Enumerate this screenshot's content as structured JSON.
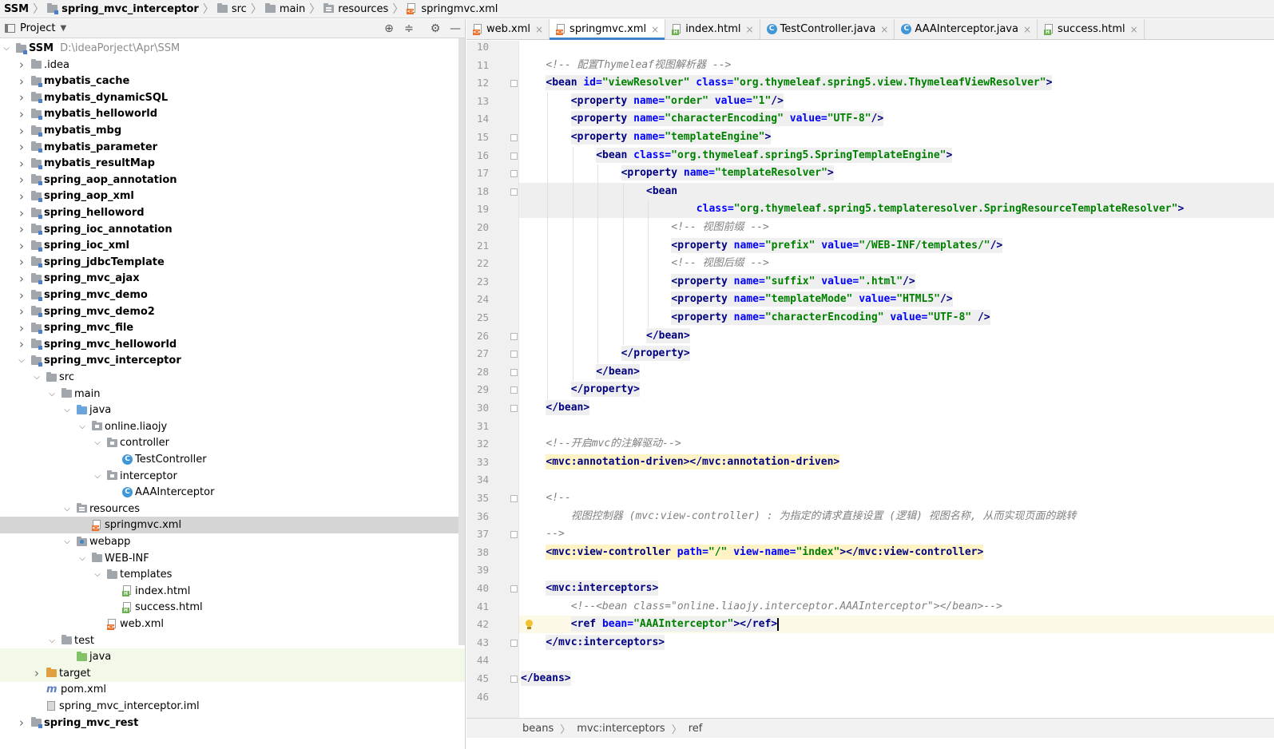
{
  "breadcrumbs": [
    {
      "label": "SSM",
      "icon": "none",
      "bold": true
    },
    {
      "label": "spring_mvc_interceptor",
      "icon": "module-folder-icon",
      "bold": true
    },
    {
      "label": "src",
      "icon": "folder-icon",
      "bold": false
    },
    {
      "label": "main",
      "icon": "folder-icon",
      "bold": false
    },
    {
      "label": "resources",
      "icon": "resources-folder-icon",
      "bold": false
    },
    {
      "label": "springmvc.xml",
      "icon": "xml-file-icon",
      "bold": false
    }
  ],
  "project_panel": {
    "title": "Project",
    "tree": [
      {
        "level": 0,
        "arrow": "open",
        "icon": "module",
        "label": "SSM",
        "bold": true,
        "path": "D:\\ideaPorject\\Apr\\SSM"
      },
      {
        "level": 1,
        "arrow": "closed",
        "icon": "folder",
        "label": ".idea",
        "bold": false
      },
      {
        "level": 1,
        "arrow": "closed",
        "icon": "module",
        "label": "mybatis_cache",
        "bold": true
      },
      {
        "level": 1,
        "arrow": "closed",
        "icon": "module",
        "label": "mybatis_dynamicSQL",
        "bold": true
      },
      {
        "level": 1,
        "arrow": "closed",
        "icon": "module",
        "label": "mybatis_helloworld",
        "bold": true
      },
      {
        "level": 1,
        "arrow": "closed",
        "icon": "module",
        "label": "mybatis_mbg",
        "bold": true
      },
      {
        "level": 1,
        "arrow": "closed",
        "icon": "module",
        "label": "mybatis_parameter",
        "bold": true
      },
      {
        "level": 1,
        "arrow": "closed",
        "icon": "module",
        "label": "mybatis_resultMap",
        "bold": true
      },
      {
        "level": 1,
        "arrow": "closed",
        "icon": "module",
        "label": "spring_aop_annotation",
        "bold": true
      },
      {
        "level": 1,
        "arrow": "closed",
        "icon": "module",
        "label": "spring_aop_xml",
        "bold": true
      },
      {
        "level": 1,
        "arrow": "closed",
        "icon": "module",
        "label": "spring_helloword",
        "bold": true
      },
      {
        "level": 1,
        "arrow": "closed",
        "icon": "module",
        "label": "spring_ioc_annotation",
        "bold": true
      },
      {
        "level": 1,
        "arrow": "closed",
        "icon": "module",
        "label": "spring_ioc_xml",
        "bold": true
      },
      {
        "level": 1,
        "arrow": "closed",
        "icon": "module",
        "label": "spring_jdbcTemplate",
        "bold": true
      },
      {
        "level": 1,
        "arrow": "closed",
        "icon": "module",
        "label": "spring_mvc_ajax",
        "bold": true
      },
      {
        "level": 1,
        "arrow": "closed",
        "icon": "module",
        "label": "spring_mvc_demo",
        "bold": true
      },
      {
        "level": 1,
        "arrow": "closed",
        "icon": "module",
        "label": "spring_mvc_demo2",
        "bold": true
      },
      {
        "level": 1,
        "arrow": "closed",
        "icon": "module",
        "label": "spring_mvc_file",
        "bold": true
      },
      {
        "level": 1,
        "arrow": "closed",
        "icon": "module",
        "label": "spring_mvc_helloworld",
        "bold": true
      },
      {
        "level": 1,
        "arrow": "open",
        "icon": "module",
        "label": "spring_mvc_interceptor",
        "bold": true
      },
      {
        "level": 2,
        "arrow": "open",
        "icon": "folder",
        "label": "src",
        "bold": false
      },
      {
        "level": 3,
        "arrow": "open",
        "icon": "folder",
        "label": "main",
        "bold": false
      },
      {
        "level": 4,
        "arrow": "open",
        "icon": "folder-blue",
        "label": "java",
        "bold": false
      },
      {
        "level": 5,
        "arrow": "open",
        "icon": "package",
        "label": "online.liaojy",
        "bold": false
      },
      {
        "level": 6,
        "arrow": "open",
        "icon": "package",
        "label": "controller",
        "bold": false
      },
      {
        "level": 7,
        "arrow": "none",
        "icon": "class",
        "label": "TestController",
        "bold": false
      },
      {
        "level": 6,
        "arrow": "open",
        "icon": "package",
        "label": "interceptor",
        "bold": false
      },
      {
        "level": 7,
        "arrow": "none",
        "icon": "class",
        "label": "AAAInterceptor",
        "bold": false
      },
      {
        "level": 4,
        "arrow": "open",
        "icon": "resources",
        "label": "resources",
        "bold": false
      },
      {
        "level": 5,
        "arrow": "none",
        "icon": "xml",
        "label": "springmvc.xml",
        "bold": false,
        "selected": true
      },
      {
        "level": 4,
        "arrow": "open",
        "icon": "webapp",
        "label": "webapp",
        "bold": false
      },
      {
        "level": 5,
        "arrow": "open",
        "icon": "folder",
        "label": "WEB-INF",
        "bold": false
      },
      {
        "level": 6,
        "arrow": "open",
        "icon": "folder",
        "label": "templates",
        "bold": false
      },
      {
        "level": 7,
        "arrow": "none",
        "icon": "html",
        "label": "index.html",
        "bold": false
      },
      {
        "level": 7,
        "arrow": "none",
        "icon": "html",
        "label": "success.html",
        "bold": false
      },
      {
        "level": 6,
        "arrow": "none",
        "icon": "xml",
        "label": "web.xml",
        "bold": false
      },
      {
        "level": 3,
        "arrow": "open",
        "icon": "folder",
        "label": "test",
        "bold": false
      },
      {
        "level": 4,
        "arrow": "none",
        "icon": "folder-green",
        "label": "java",
        "bold": false,
        "highlight": true
      },
      {
        "level": 2,
        "arrow": "closed",
        "icon": "folder-orange",
        "label": "target",
        "bold": false,
        "highlight": true
      },
      {
        "level": 2,
        "arrow": "none",
        "icon": "maven",
        "label": "pom.xml",
        "bold": false
      },
      {
        "level": 2,
        "arrow": "none",
        "icon": "iml",
        "label": "spring_mvc_interceptor.iml",
        "bold": false
      },
      {
        "level": 1,
        "arrow": "closed",
        "icon": "module",
        "label": "spring_mvc_rest",
        "bold": true
      }
    ]
  },
  "tabs": [
    {
      "label": "web.xml",
      "icon": "xml",
      "active": false
    },
    {
      "label": "springmvc.xml",
      "icon": "xml",
      "active": true
    },
    {
      "label": "index.html",
      "icon": "html",
      "active": false
    },
    {
      "label": "TestController.java",
      "icon": "class",
      "active": false
    },
    {
      "label": "AAAInterceptor.java",
      "icon": "class",
      "active": false
    },
    {
      "label": "success.html",
      "icon": "html",
      "active": false
    }
  ],
  "editor": {
    "current_line": 42,
    "lines": [
      {
        "n": "10",
        "fold": false,
        "segs": []
      },
      {
        "n": "11",
        "fold": false,
        "indent": 1,
        "segs": [
          {
            "c": "cm",
            "t": "<!-- 配置Thymeleaf视图解析器 -->"
          }
        ]
      },
      {
        "n": "12",
        "fold": true,
        "indent": 1,
        "bg": "bg",
        "segs": [
          {
            "c": "tg",
            "t": "<bean "
          },
          {
            "c": "at",
            "t": "id="
          },
          {
            "c": "av",
            "t": "\"viewResolver\""
          },
          {
            "c": "tg",
            "t": " "
          },
          {
            "c": "at",
            "t": "class="
          },
          {
            "c": "av",
            "t": "\"org.thymeleaf.spring5.view.ThymeleafViewResolver\""
          },
          {
            "c": "tg",
            "t": ">"
          }
        ]
      },
      {
        "n": "13",
        "fold": false,
        "indent": 2,
        "bg": "bg",
        "segs": [
          {
            "c": "tg",
            "t": "<property "
          },
          {
            "c": "at",
            "t": "name="
          },
          {
            "c": "av",
            "t": "\"order\""
          },
          {
            "c": "tg",
            "t": " "
          },
          {
            "c": "at",
            "t": "value="
          },
          {
            "c": "av",
            "t": "\"1\""
          },
          {
            "c": "tg",
            "t": "/>"
          }
        ]
      },
      {
        "n": "14",
        "fold": false,
        "indent": 2,
        "bg": "bg",
        "segs": [
          {
            "c": "tg",
            "t": "<property "
          },
          {
            "c": "at",
            "t": "name="
          },
          {
            "c": "av",
            "t": "\"characterEncoding\""
          },
          {
            "c": "tg",
            "t": " "
          },
          {
            "c": "at",
            "t": "value="
          },
          {
            "c": "av",
            "t": "\"UTF-8\""
          },
          {
            "c": "tg",
            "t": "/>"
          }
        ]
      },
      {
        "n": "15",
        "fold": true,
        "indent": 2,
        "bg": "bg",
        "segs": [
          {
            "c": "tg",
            "t": "<property "
          },
          {
            "c": "at",
            "t": "name="
          },
          {
            "c": "av",
            "t": "\"templateEngine\""
          },
          {
            "c": "tg",
            "t": ">"
          }
        ]
      },
      {
        "n": "16",
        "fold": true,
        "indent": 3,
        "bg": "bg",
        "segs": [
          {
            "c": "tg",
            "t": "<bean "
          },
          {
            "c": "at",
            "t": "class="
          },
          {
            "c": "av",
            "t": "\"org.thymeleaf.spring5.SpringTemplateEngine\""
          },
          {
            "c": "tg",
            "t": ">"
          }
        ]
      },
      {
        "n": "17",
        "fold": true,
        "indent": 4,
        "bg": "bg",
        "segs": [
          {
            "c": "tg",
            "t": "<property "
          },
          {
            "c": "at",
            "t": "name="
          },
          {
            "c": "av",
            "t": "\"templateResolver\""
          },
          {
            "c": "tg",
            "t": ">"
          }
        ]
      },
      {
        "n": "18",
        "fold": true,
        "indent": 5,
        "bg": "bg",
        "fullbg": true,
        "segs": [
          {
            "c": "tg",
            "t": "<bean"
          }
        ]
      },
      {
        "n": "19",
        "fold": false,
        "indent": 7,
        "bg": "bg",
        "fullbg": true,
        "segs": [
          {
            "c": "at",
            "t": "class="
          },
          {
            "c": "av",
            "t": "\"org.thymeleaf.spring5.templateresolver.SpringResourceTemplateResolver\""
          },
          {
            "c": "tg",
            "t": ">"
          }
        ]
      },
      {
        "n": "20",
        "fold": false,
        "indent": 6,
        "segs": [
          {
            "c": "cm",
            "t": "<!-- 视图前缀 -->"
          }
        ]
      },
      {
        "n": "21",
        "fold": false,
        "indent": 6,
        "bg": "bg",
        "segs": [
          {
            "c": "tg",
            "t": "<property "
          },
          {
            "c": "at",
            "t": "name="
          },
          {
            "c": "av",
            "t": "\"prefix\""
          },
          {
            "c": "tg",
            "t": " "
          },
          {
            "c": "at",
            "t": "value="
          },
          {
            "c": "av",
            "t": "\"/WEB-INF/templates/\""
          },
          {
            "c": "tg",
            "t": "/>"
          }
        ]
      },
      {
        "n": "22",
        "fold": false,
        "indent": 6,
        "segs": [
          {
            "c": "cm",
            "t": "<!-- 视图后缀 -->"
          }
        ]
      },
      {
        "n": "23",
        "fold": false,
        "indent": 6,
        "bg": "bg",
        "segs": [
          {
            "c": "tg",
            "t": "<property "
          },
          {
            "c": "at",
            "t": "name="
          },
          {
            "c": "av",
            "t": "\"suffix\""
          },
          {
            "c": "tg",
            "t": " "
          },
          {
            "c": "at",
            "t": "value="
          },
          {
            "c": "av",
            "t": "\".html\""
          },
          {
            "c": "tg",
            "t": "/>"
          }
        ]
      },
      {
        "n": "24",
        "fold": false,
        "indent": 6,
        "bg": "bg",
        "segs": [
          {
            "c": "tg",
            "t": "<property "
          },
          {
            "c": "at",
            "t": "name="
          },
          {
            "c": "av",
            "t": "\"templateMode\""
          },
          {
            "c": "tg",
            "t": " "
          },
          {
            "c": "at",
            "t": "value="
          },
          {
            "c": "av",
            "t": "\"HTML5\""
          },
          {
            "c": "tg",
            "t": "/>"
          }
        ]
      },
      {
        "n": "25",
        "fold": false,
        "indent": 6,
        "bg": "bg",
        "segs": [
          {
            "c": "tg",
            "t": "<property "
          },
          {
            "c": "at",
            "t": "name="
          },
          {
            "c": "av",
            "t": "\"characterEncoding\""
          },
          {
            "c": "tg",
            "t": " "
          },
          {
            "c": "at",
            "t": "value="
          },
          {
            "c": "av",
            "t": "\"UTF-8\""
          },
          {
            "c": "tg",
            "t": " />"
          }
        ]
      },
      {
        "n": "26",
        "fold": true,
        "indent": 5,
        "bg": "bg",
        "segs": [
          {
            "c": "tg",
            "t": "</bean>"
          }
        ]
      },
      {
        "n": "27",
        "fold": true,
        "indent": 4,
        "bg": "bg",
        "segs": [
          {
            "c": "tg",
            "t": "</property>"
          }
        ]
      },
      {
        "n": "28",
        "fold": true,
        "indent": 3,
        "bg": "bg",
        "segs": [
          {
            "c": "tg",
            "t": "</bean>"
          }
        ]
      },
      {
        "n": "29",
        "fold": true,
        "indent": 2,
        "bg": "bg",
        "segs": [
          {
            "c": "tg",
            "t": "</property>"
          }
        ]
      },
      {
        "n": "30",
        "fold": true,
        "indent": 1,
        "bg": "bg",
        "segs": [
          {
            "c": "tg",
            "t": "</bean>"
          }
        ]
      },
      {
        "n": "31",
        "fold": false,
        "segs": []
      },
      {
        "n": "32",
        "fold": false,
        "indent": 1,
        "segs": [
          {
            "c": "cm",
            "t": "<!--开启mvc的注解驱动-->"
          }
        ]
      },
      {
        "n": "33",
        "fold": false,
        "indent": 1,
        "bg": "ybg",
        "segs": [
          {
            "c": "tg",
            "t": "<mvc:annotation-driven></mvc:annotation-driven>"
          }
        ]
      },
      {
        "n": "34",
        "fold": false,
        "segs": []
      },
      {
        "n": "35",
        "fold": true,
        "indent": 1,
        "segs": [
          {
            "c": "cm",
            "t": "<!--"
          }
        ]
      },
      {
        "n": "36",
        "fold": false,
        "indent": 2,
        "segs": [
          {
            "c": "cm",
            "t": "视图控制器 (mvc:view-controller) : 为指定的请求直接设置 (逻辑) 视图名称, 从而实现页面的跳转"
          }
        ]
      },
      {
        "n": "37",
        "fold": true,
        "indent": 1,
        "segs": [
          {
            "c": "cm",
            "t": "-->"
          }
        ]
      },
      {
        "n": "38",
        "fold": false,
        "indent": 1,
        "bg": "ybg",
        "segs": [
          {
            "c": "tg",
            "t": "<mvc:view-controller "
          },
          {
            "c": "at",
            "t": "path="
          },
          {
            "c": "av",
            "t": "\"/\""
          },
          {
            "c": "tg",
            "t": " "
          },
          {
            "c": "at",
            "t": "view-name="
          },
          {
            "c": "av",
            "t": "\"index\""
          },
          {
            "c": "tg",
            "t": "></mvc:view-controller>"
          }
        ]
      },
      {
        "n": "39",
        "fold": false,
        "segs": []
      },
      {
        "n": "40",
        "fold": true,
        "indent": 1,
        "bg": "bg",
        "segs": [
          {
            "c": "tg",
            "t": "<mvc:interceptors>"
          }
        ]
      },
      {
        "n": "41",
        "fold": false,
        "indent": 2,
        "segs": [
          {
            "c": "cm",
            "t": "<!--<bean class=\"online.liaojy.interceptor.AAAInterceptor\"></bean>-->"
          }
        ]
      },
      {
        "n": "42",
        "fold": false,
        "indent": 2,
        "bulb": true,
        "bg": "bg",
        "caret": true,
        "segs": [
          {
            "c": "tg",
            "t": "<ref "
          },
          {
            "c": "at",
            "t": "bean="
          },
          {
            "c": "av",
            "t": "\"AAAInterceptor\""
          },
          {
            "c": "tg",
            "t": "></ref>"
          }
        ]
      },
      {
        "n": "43",
        "fold": true,
        "indent": 1,
        "bg": "bg",
        "segs": [
          {
            "c": "tg",
            "t": "</mvc:interceptors>"
          }
        ]
      },
      {
        "n": "44",
        "fold": false,
        "segs": []
      },
      {
        "n": "45",
        "fold": true,
        "indent": 0,
        "bg": "bg",
        "segs": [
          {
            "c": "tg",
            "t": "</beans>"
          }
        ]
      },
      {
        "n": "46",
        "fold": false,
        "segs": []
      }
    ]
  },
  "status_breadcrumbs": [
    "beans",
    "mvc:interceptors",
    "ref"
  ],
  "colors": {
    "tag": "#000080",
    "attr": "#0000ff",
    "value": "#008000",
    "comment": "#808080",
    "accent": "#4083c9"
  }
}
